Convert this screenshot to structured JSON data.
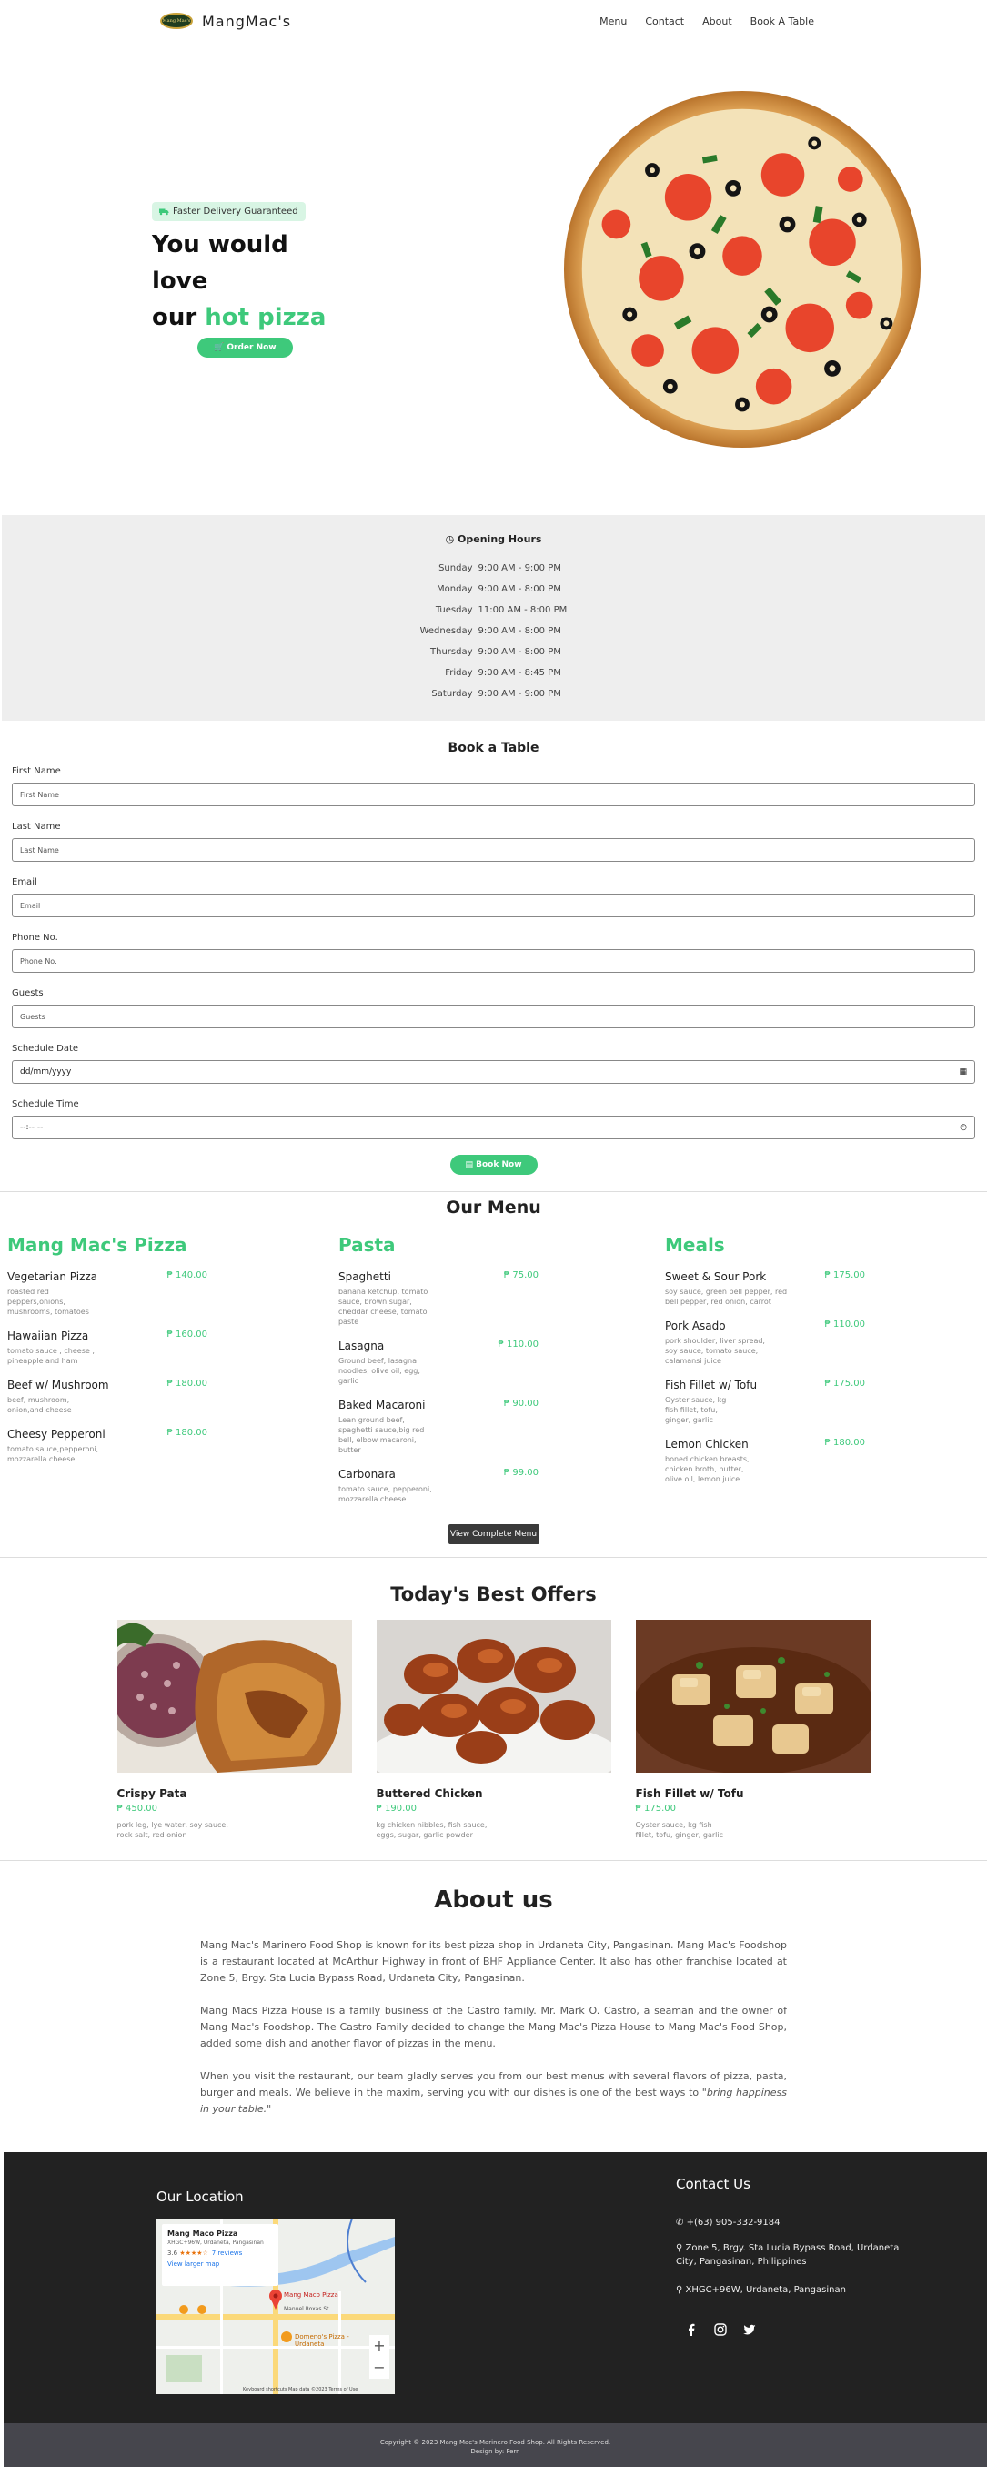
{
  "nav": {
    "brand": "MangMac's",
    "logo_text": "Mang Mac's",
    "links": [
      "Menu",
      "Contact",
      "About",
      "Book A Table"
    ]
  },
  "hero": {
    "badge": "Faster Delivery Guaranteed",
    "title_line1": "You would love",
    "title_line2_prefix": "our",
    "title_line2_highlight": "hot pizza",
    "order_button": "Order Now"
  },
  "hours": {
    "title": "Opening Hours",
    "rows": [
      {
        "day": "Sunday",
        "time": "9:00 AM - 9:00 PM"
      },
      {
        "day": "Monday",
        "time": "9:00 AM - 8:00 PM"
      },
      {
        "day": "Tuesday",
        "time": "11:00 AM - 8:00 PM"
      },
      {
        "day": "Wednesday",
        "time": "9:00 AM - 8:00 PM"
      },
      {
        "day": "Thursday",
        "time": "9:00 AM - 8:00 PM"
      },
      {
        "day": "Friday",
        "time": "9:00 AM - 8:45 PM"
      },
      {
        "day": "Saturday",
        "time": "9:00 AM - 9:00 PM"
      }
    ]
  },
  "booking": {
    "title": "Book a Table",
    "fields": [
      {
        "label": "First Name",
        "placeholder": "First Name"
      },
      {
        "label": "Last Name",
        "placeholder": "Last Name"
      },
      {
        "label": "Email",
        "placeholder": "Email"
      },
      {
        "label": "Phone No.",
        "placeholder": "Phone No."
      },
      {
        "label": "Guests",
        "placeholder": "Guests"
      },
      {
        "label": "Schedule Date",
        "placeholder": "dd/mm/yyyy"
      },
      {
        "label": "Schedule Time",
        "placeholder": "--:-- --"
      }
    ],
    "submit": "Book Now"
  },
  "menu": {
    "title": "Our Menu",
    "columns": [
      {
        "heading": "Mang Mac's Pizza",
        "items": [
          {
            "name": "Vegetarian Pizza",
            "price": "₱ 140.00",
            "desc": "roasted red peppers,onions, mushrooms, tomatoes"
          },
          {
            "name": "Hawaiian Pizza",
            "price": "₱ 160.00",
            "desc": "tomato sauce , cheese , pineapple and ham"
          },
          {
            "name": "Beef w/ Mushroom",
            "price": "₱ 180.00",
            "desc": "beef, mushroom, onion,and cheese"
          },
          {
            "name": "Cheesy Pepperoni",
            "price": "₱ 180.00",
            "desc": "tomato sauce,pepperoni, mozzarella cheese"
          }
        ]
      },
      {
        "heading": "Pasta",
        "items": [
          {
            "name": "Spaghetti",
            "price": "₱ 75.00",
            "desc": "banana ketchup, tomato sauce, brown sugar, cheddar cheese, tomato paste"
          },
          {
            "name": "Lasagna",
            "price": "₱ 110.00",
            "desc": "Ground beef, lasagna noodles, olive oil, egg, garlic"
          },
          {
            "name": "Baked Macaroni",
            "price": "₱ 90.00",
            "desc": "Lean ground beef, spaghetti sauce,big red bell, elbow macaroni, butter"
          },
          {
            "name": "Carbonara",
            "price": "₱ 99.00",
            "desc": "tomato sauce, pepperoni, mozzarella cheese"
          }
        ]
      },
      {
        "heading": "Meals",
        "items": [
          {
            "name": "Sweet & Sour Pork",
            "price": "₱ 175.00",
            "desc": "soy sauce, green bell pepper, red bell pepper, red onion, carrot"
          },
          {
            "name": "Pork Asado",
            "price": "₱ 110.00",
            "desc": "pork shoulder, liver spread, soy sauce, tomato sauce, calamansi juice"
          },
          {
            "name": "Fish Fillet w/ Tofu",
            "price": "₱ 175.00",
            "desc": "Oyster sauce, kg fish fillet, tofu, ginger, garlic"
          },
          {
            "name": "Lemon Chicken",
            "price": "₱ 180.00",
            "desc": "boned chicken breasts, chicken broth, butter, olive oil, lemon juice"
          }
        ]
      }
    ],
    "view_button": "View Complete Menu"
  },
  "offers": {
    "title": "Today's Best Offers",
    "items": [
      {
        "name": "Crispy Pata",
        "price": "₱ 450.00",
        "desc": "pork leg, lye water, soy sauce, rock salt, red onion"
      },
      {
        "name": "Buttered Chicken",
        "price": "₱ 190.00",
        "desc": "kg chicken nibbles, fish sauce, eggs, sugar, garlic powder"
      },
      {
        "name": "Fish Fillet w/ Tofu",
        "price": "₱ 175.00",
        "desc": "Oyster sauce, kg fish fillet, tofu, ginger, garlic"
      }
    ]
  },
  "about": {
    "title": "About us",
    "p1": "Mang Mac's Marinero Food Shop is known for its best pizza shop in Urdaneta City, Pangasinan. Mang Mac's Foodshop is a restaurant located at McArthur Highway in front of BHF Appliance Center. It also has other franchise located at Zone 5, Brgy. Sta Lucia Bypass Road, Urdaneta City, Pangasinan.",
    "p2": "Mang Macs Pizza House is a family business of the Castro family. Mr. Mark O. Castro, a seaman and the owner of Mang Mac's Foodshop. The Castro Family decided to change the Mang Mac's Pizza House to Mang Mac's Food Shop, added some dish and another flavor of pizzas in the menu.",
    "p3_text": "When you visit the restaurant, our team gladly serves you from our best menus with several flavors of pizza, pasta, burger and meals. We believe in the maxim, serving you with our dishes is one of the best ways to ",
    "p3_quote": "\"bring happiness in your table.\""
  },
  "footer": {
    "location_title": "Our Location",
    "map": {
      "name": "Mang Maco Pizza",
      "address": "XHGC+96W, Urdaneta, Pangasinan",
      "rating": "3.6",
      "stars": "★★★★☆",
      "reviews": "7 reviews",
      "link": "View larger map",
      "pin1": "Mang Maco Pizza",
      "pin2": "Domeno's Pizza - Urdaneta",
      "street": "Manuel Roxas St.",
      "footer": "Keyboard shortcuts   Map data ©2023   Terms of Use"
    },
    "contact_title": "Contact Us",
    "phone": "+(63) 905-332-9184",
    "address": "Zone 5, Brgy. Sta Lucia Bypass Road, Urdaneta City, Pangasinan, Philippines",
    "plus_code": "XHGC+96W, Urdaneta, Pangasinan",
    "copyright": "Copyright © 2023 Mang Mac's Marinero Food Shop. All Rights Reserved.",
    "credit": "Design by: Fern"
  },
  "colors": {
    "accent": "#3ec97b",
    "footer_bg": "#222222",
    "copyright_bg": "#46464d"
  }
}
